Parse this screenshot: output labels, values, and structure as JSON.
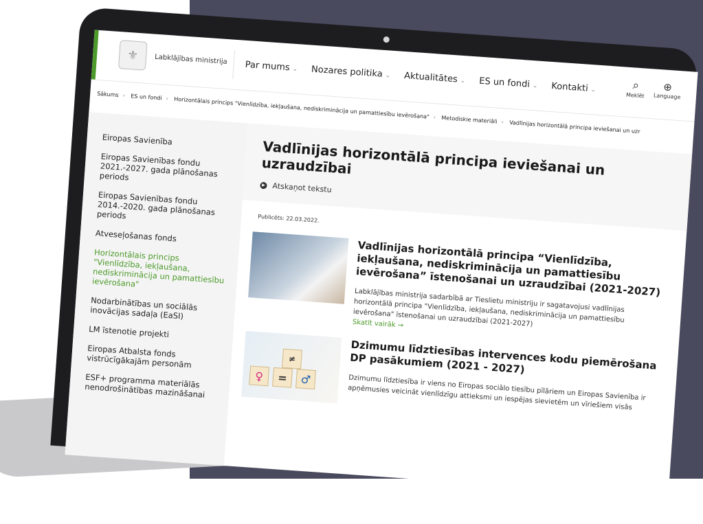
{
  "header": {
    "org_name": "Labklājības ministrija",
    "nav": [
      "Par mums",
      "Nozares politika",
      "Aktualitātes",
      "ES un fondi",
      "Kontakti"
    ],
    "search_label": "Meklēt",
    "language_label": "Language"
  },
  "breadcrumbs": [
    "Sākums",
    "ES un fondi",
    "Horizontālais princips \"Vienlīdzība, iekļaušana, nediskriminācija un pamattiesību ievērošana\"",
    "Metodiskie materiāli",
    "Vadlīnijas horizontālā principa ieviešanai un uzr"
  ],
  "sidebar": [
    "Eiropas Savienība",
    "Eiropas Savienības fondu 2021.-2027. gada plānošanas periods",
    "Eiropas Savienības fondu 2014.-2020. gada plānošanas periods",
    "Atveseļošanas fonds",
    "Horizontālais princips \"Vienlīdzība, iekļaušana, nediskriminācija un pamattiesību ievērošana\"",
    "Nodarbinātības un sociālās inovācijas sadaļa (EaSI)",
    "LM īstenotie projekti",
    "Eiropas Atbalsta fonds vistrūcīgākajām personām",
    "ESF+ programma materiālās nenodrošinātības mazināšanai"
  ],
  "page": {
    "title": "Vadlīnijas horizontālā principa ieviešanai un uzraudzībai",
    "listen": "Atskaņot tekstu",
    "published": "Publicēts: 22.03.2022."
  },
  "articles": [
    {
      "title": "Vadlīnijas horizontālā principa “Vienlīdzība, iekļaušana, nediskriminācija un pamattiesību ievērošana” īstenošanai un uzraudzībai (2021-2027)",
      "summary": "Labklājības ministrija sadarbībā ar Tieslietu ministriju ir sagatavojusi vadlīnijas horizontālā principa \"Vienlīdzība, iekļaušana, nediskriminācija un pamattiesību ievērošana\" īstenošanai un uzraudzībai (2021-2027)",
      "more": "Skatīt vairāk →"
    },
    {
      "title": "Dzimumu līdztiesības intervences kodu piemērošana DP pasākumiem (2021 - 2027)",
      "summary": "Dzimumu līdztiesība ir viens no Eiropas sociālo tiesību pīlāriem un Eiropas Savienība ir apņēmusies veicināt vienlīdzīgu attieksmi un iespējas sievietēm un vīriešiem visās"
    }
  ],
  "icons": {
    "search": "search-icon",
    "globe": "globe-icon",
    "chevron": "chevron-down-icon",
    "play": "play-icon"
  },
  "colors": {
    "accent": "#4c9a2a",
    "dark_bg": "#4a4a5e"
  }
}
